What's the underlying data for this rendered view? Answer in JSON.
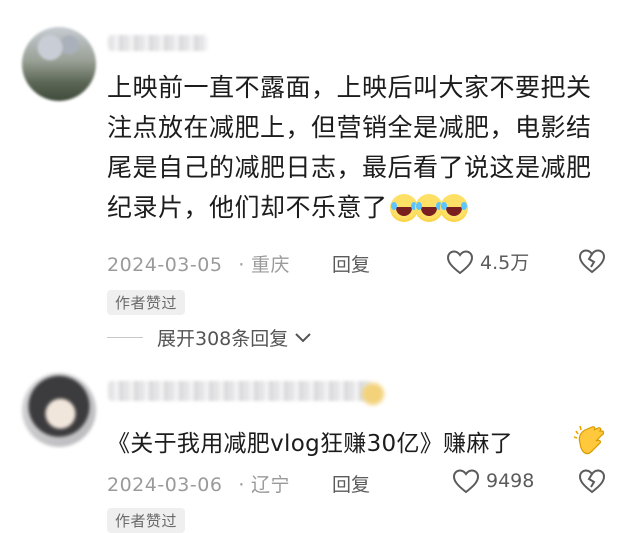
{
  "comments": [
    {
      "text": "上映前一直不露面，上映后叫大家不要把关注点放在减肥上，但营销全是减肥，电影结尾是自己的减肥日志，最后看了说这是减肥纪录片，他们却不乐意了",
      "emojis": [
        "laughing-crying-emoji",
        "laughing-crying-emoji",
        "laughing-crying-emoji"
      ],
      "date": "2024-03-05",
      "location": "重庆",
      "reply_label": "回复",
      "likes": "4.5万",
      "badge": "作者赞过",
      "expand_label": "展开308条回复"
    },
    {
      "text": "《关于我用减肥vlog狂赚30亿》赚麻了",
      "emojis": [
        "clapping-hands-emoji"
      ],
      "date": "2024-03-06",
      "location": "辽宁",
      "reply_label": "回复",
      "likes": "9498",
      "badge": "作者赞过"
    }
  ],
  "colors": {
    "meta_gray": "#9a9a9a",
    "icon_gray": "#5b5b5b",
    "text": "#1c1c1c"
  }
}
